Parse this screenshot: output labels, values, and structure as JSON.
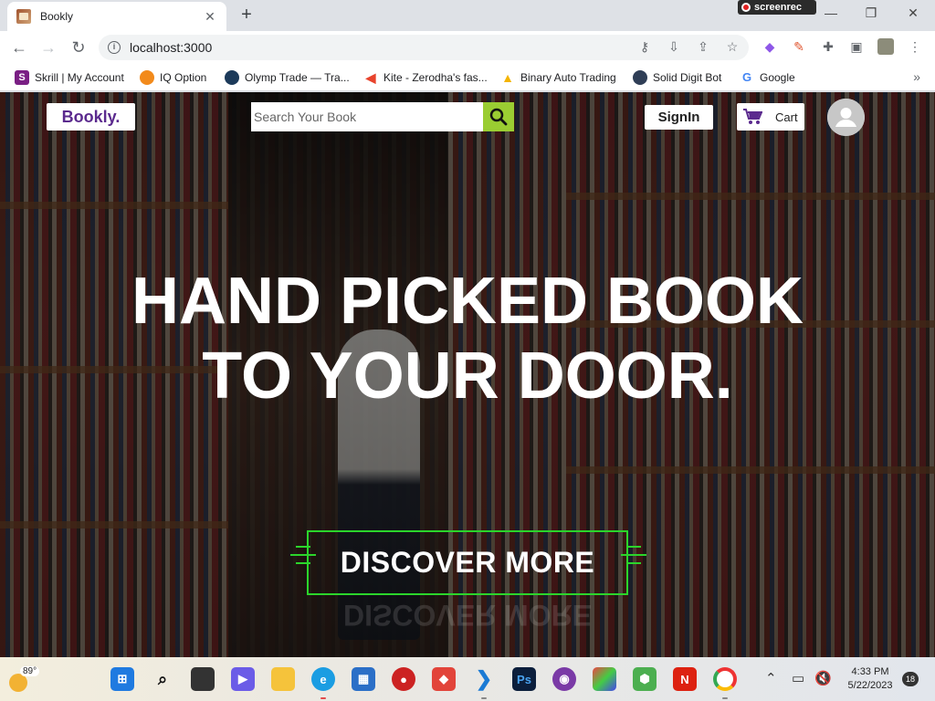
{
  "browser": {
    "tab_title": "Bookly",
    "url": "localhost:3000",
    "recorder_label": "screenrec",
    "bookmarks": [
      {
        "label": "Skrill | My Account",
        "icon": "S",
        "color": "#7a1f84"
      },
      {
        "label": "IQ Option",
        "icon": "iq",
        "color": "#f28a1b"
      },
      {
        "label": "Olymp Trade — Tra...",
        "icon": "o",
        "color": "#1c3a5a"
      },
      {
        "label": "Kite - Zerodha's fas...",
        "icon": "k",
        "color": "#e8432c"
      },
      {
        "label": "Binary Auto Trading",
        "icon": "b",
        "color": "#f4b400"
      },
      {
        "label": "Solid Digit Bot",
        "icon": "s",
        "color": "#2f3e56"
      },
      {
        "label": "Google",
        "icon": "G",
        "color": "#4285f4"
      }
    ]
  },
  "page": {
    "logo": "Bookly.",
    "search_placeholder": "Search Your Book",
    "signin_label": "SignIn",
    "cart_label": "Cart",
    "headline_line1": "HAND PICKED BOOK",
    "headline_line2": "TO YOUR DOOR.",
    "cta_label": "DISCOVER MORE",
    "accent_color": "#2bd52b",
    "search_button_color": "#9acd32",
    "logo_color": "#5b2a8e"
  },
  "taskbar": {
    "weather_temp": "89°",
    "time": "4:33 PM",
    "date": "5/22/2023",
    "notification_count": "18"
  }
}
